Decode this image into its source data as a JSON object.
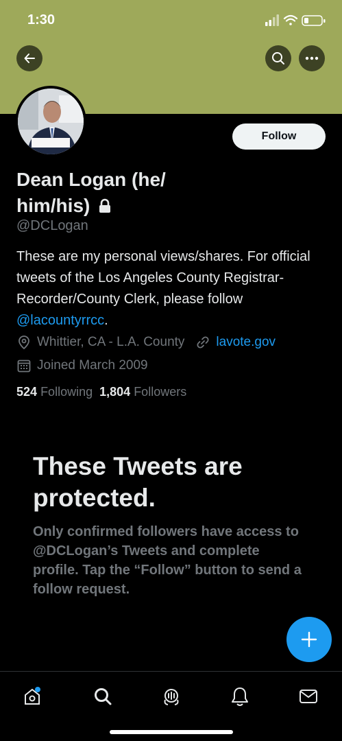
{
  "status_bar": {
    "time": "1:30"
  },
  "profile": {
    "name": "Dean Logan (he/ him/his)",
    "handle": "@DCLogan",
    "follow_label": "Follow",
    "bio_text": "These are my personal views/shares. For official tweets of the Los Angeles County Registrar-Recorder/County Clerk, please follow ",
    "bio_link": "@lacountyrrcc",
    "bio_end": ".",
    "location": "Whittier, CA - L.A. County",
    "website": "lavote.gov",
    "joined": "Joined March 2009",
    "following_count": "524",
    "following_label": "Following",
    "followers_count": "1,804",
    "followers_label": "Followers"
  },
  "protected": {
    "title": "These Tweets are protected.",
    "body": "Only confirmed followers have access to @DCLogan’s Tweets and complete profile. Tap the “Follow” button to send a follow request."
  },
  "colors": {
    "banner": "#9ea95a",
    "accent": "#1d9bf0",
    "background": "#000000",
    "muted_text": "#71767b"
  },
  "icons": {
    "back": "arrow-left-icon",
    "search": "search-icon",
    "more": "more-icon",
    "lock": "lock-icon",
    "location": "location-pin-icon",
    "link": "link-icon",
    "calendar": "calendar-icon",
    "compose": "plus-icon",
    "tabs": [
      "home-icon",
      "search-icon",
      "spaces-icon",
      "notifications-icon",
      "messages-icon"
    ]
  }
}
